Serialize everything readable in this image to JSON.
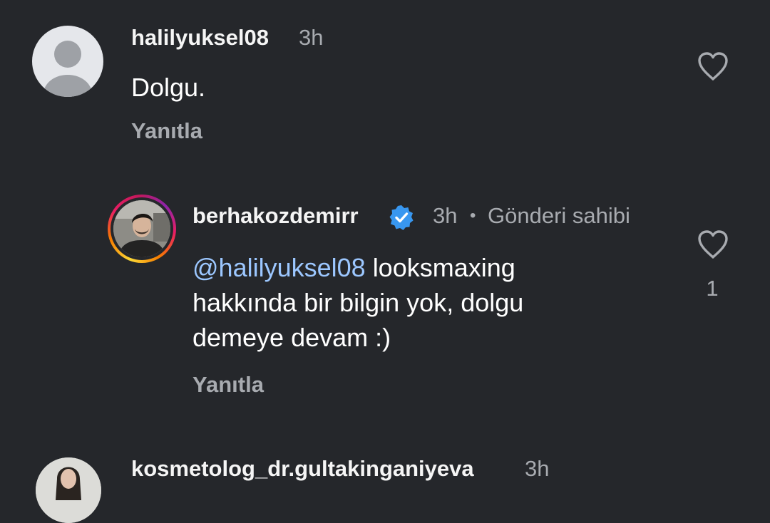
{
  "comments": [
    {
      "username": "halilyuksel08",
      "time": "3h",
      "text": "Dolgu.",
      "reply_label": "Yanıtla"
    },
    {
      "username": "berhakozdemirr",
      "verified": true,
      "time": "3h",
      "separator": "•",
      "owner_label": "Gönderi sahibi",
      "mention": "@halilyuksel08",
      "text_line1_rest": "looksmaxing",
      "text_line2": "hakkında bir bilgin yok, dolgu",
      "text_line3": "demeye devam :)",
      "like_count": "1",
      "reply_label": "Yanıtla"
    },
    {
      "username": "kosmetolog_dr.gultakinganiyeva",
      "time": "3h"
    }
  ],
  "icons": {
    "like": "heart-outline-icon",
    "verified": "verified-badge-icon"
  },
  "colors": {
    "background": "#25272b",
    "mention": "#9cc7ff",
    "verified": "#3897f0",
    "muted": "#a8abb0"
  }
}
